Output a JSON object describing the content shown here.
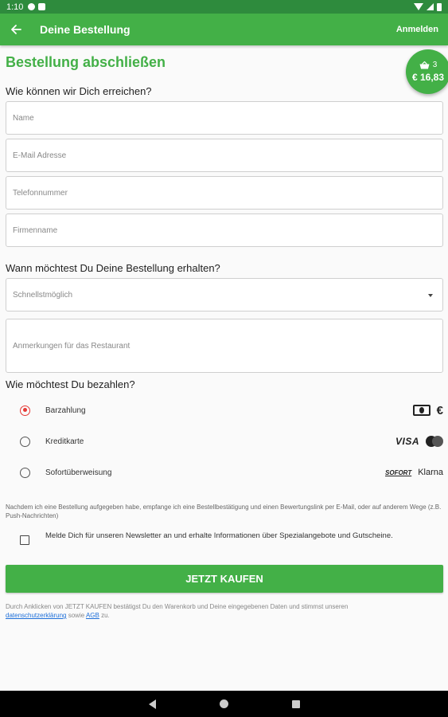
{
  "status_bar": {
    "time": "1:10"
  },
  "app_bar": {
    "title": "Deine Bestellung",
    "login_label": "Anmelden"
  },
  "page_heading": "Bestellung abschließen",
  "cart": {
    "count": "3",
    "total": "€ 16,83"
  },
  "contact": {
    "question": "Wie können wir Dich erreichen?",
    "name_placeholder": "Name",
    "email_placeholder": "E-Mail Adresse",
    "phone_placeholder": "Telefonnummer",
    "company_placeholder": "Firmenname"
  },
  "delivery": {
    "question": "Wann möchtest Du Deine Bestellung erhalten?",
    "time_selected": "Schnellstmöglich",
    "notes_placeholder": "Anmerkungen für das Restaurant"
  },
  "payment": {
    "question": "Wie möchtest Du bezahlen?",
    "options": [
      {
        "label": "Barzahlung",
        "selected": true,
        "icons": [
          "cash-icon",
          "euro-icon"
        ]
      },
      {
        "label": "Kreditkarte",
        "selected": false,
        "brand_text": "VISA",
        "icons": [
          "mastercard-icon"
        ]
      },
      {
        "label": "Sofortüberweisung",
        "selected": false,
        "brand_text": "SOFORT",
        "brand_text_2": "Klarna"
      }
    ]
  },
  "confirmation_note": "Nachdem ich eine Bestellung aufgegeben habe, empfange ich eine Bestellbestätigung und einen Bewertungslink per E-Mail, oder auf anderem Wege (z.B. Push-Nachrichten)",
  "newsletter": {
    "checked": false,
    "label": "Melde Dich für unseren Newsletter an und erhalte Informationen über Spezialangebote und Gutscheine."
  },
  "buy_button_label": "JETZT KAUFEN",
  "legal": {
    "prefix": "Durch Anklicken von JETZT KAUFEN bestätigst Du den Warenkorb und Deine eingegebenen Daten und stimmst unseren",
    "privacy_link": "datenschutzerklärung",
    "middle": "sowie",
    "terms_link": "AGB",
    "suffix": "zu."
  },
  "colors": {
    "primary": "#43b047",
    "status_bar": "#2e8b3d",
    "radio_selected": "#e53935",
    "link": "#1e6fd9"
  }
}
